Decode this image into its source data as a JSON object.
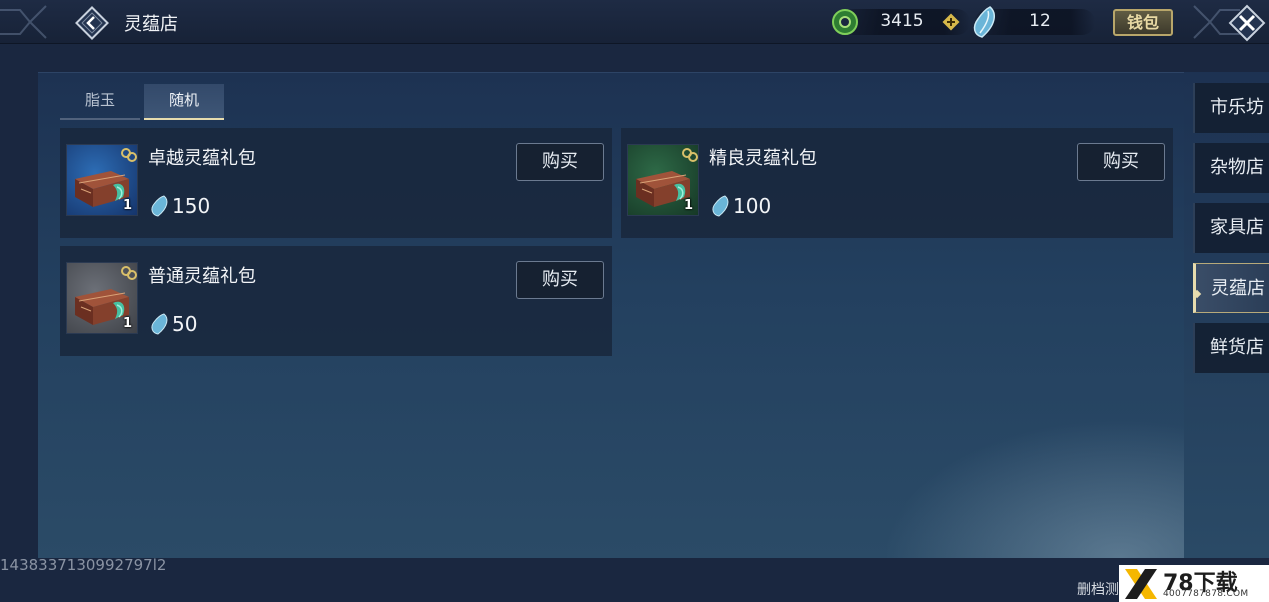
{
  "header": {
    "title": "灵蕴店",
    "currency_1_value": "3415",
    "currency_2_value": "12",
    "wallet_label": "钱包",
    "back_icon": "chevron-left-icon",
    "close_icon": "close-icon"
  },
  "tabs": [
    {
      "label": "脂玉",
      "active": false
    },
    {
      "label": "随机",
      "active": true
    }
  ],
  "items": [
    {
      "name": "卓越灵蕴礼包",
      "price": "150",
      "qty": "1",
      "buy_label": "购买",
      "rarity_color": "#1e4a8a"
    },
    {
      "name": "精良灵蕴礼包",
      "price": "100",
      "qty": "1",
      "buy_label": "购买",
      "rarity_color": "#1f4a34"
    },
    {
      "name": "普通灵蕴礼包",
      "price": "50",
      "qty": "1",
      "buy_label": "购买",
      "rarity_color": "#55585e"
    }
  ],
  "sidebar": {
    "items": [
      {
        "label": "市乐坊",
        "active": false
      },
      {
        "label": "杂物店",
        "active": false
      },
      {
        "label": "家具店",
        "active": false
      },
      {
        "label": "灵蕴店",
        "active": true
      },
      {
        "label": "鲜货店",
        "active": false
      }
    ]
  },
  "footer": {
    "id_text": "1438337130992797l2",
    "note": "删档测",
    "watermark_main": "78下载",
    "watermark_sub": "4007787878.COM"
  },
  "colors": {
    "accent": "#e7dcae",
    "panel": "#1d3252",
    "currency_green": "#3c9a3f",
    "jade_blue": "#6ab5d8"
  }
}
